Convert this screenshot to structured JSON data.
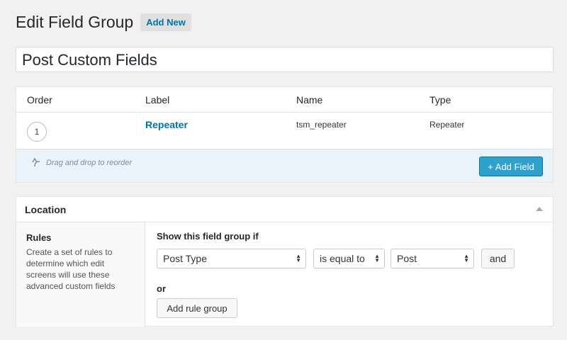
{
  "header": {
    "title": "Edit Field Group",
    "add_new_label": "Add New"
  },
  "field_group_title": "Post Custom Fields",
  "fields_table": {
    "columns": [
      "Order",
      "Label",
      "Name",
      "Type"
    ],
    "rows": [
      {
        "order": "1",
        "label": "Repeater",
        "name": "tsm_repeater",
        "type": "Repeater"
      }
    ],
    "drag_hint": "Drag and drop to reorder",
    "add_field_label": "+ Add Field"
  },
  "location": {
    "title": "Location",
    "rules_title": "Rules",
    "rules_description": "Create a set of rules to determine which edit screens will use these advanced custom fields",
    "show_if_label": "Show this field group if",
    "rule": {
      "param": "Post Type",
      "operator": "is equal to",
      "value": "Post"
    },
    "and_label": "and",
    "or_label": "or",
    "add_rule_group_label": "Add rule group"
  },
  "colors": {
    "link": "#0073aa",
    "primary_button": "#2ea2cc",
    "footer_bg": "#eaf2fa"
  }
}
